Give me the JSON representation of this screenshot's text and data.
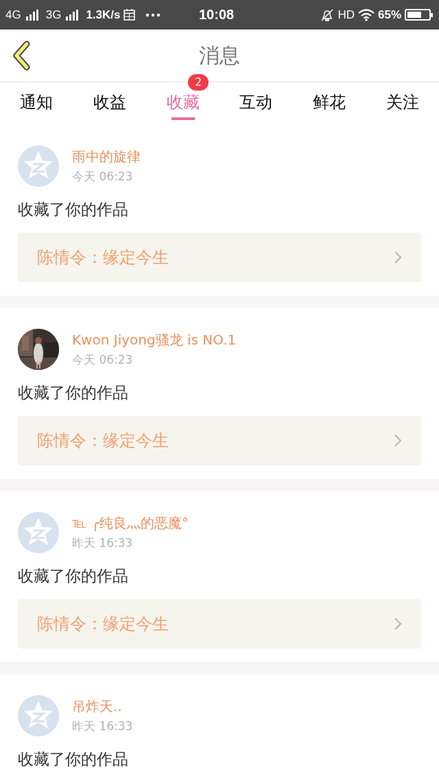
{
  "status_bar": {
    "network_1": "4G",
    "network_2": "3G",
    "speed": "1.3K/s",
    "time": "10:08",
    "hd": "HD",
    "battery": "65%"
  },
  "header": {
    "title": "消息"
  },
  "tabs": [
    {
      "label": "通知",
      "selected": false
    },
    {
      "label": "收益",
      "selected": false
    },
    {
      "label": "收藏",
      "selected": true,
      "badge": "2"
    },
    {
      "label": "互动",
      "selected": false
    },
    {
      "label": "鲜花",
      "selected": false
    },
    {
      "label": "关注",
      "selected": false
    }
  ],
  "messages": [
    {
      "kind": "default",
      "name": "雨中的旋律",
      "time": "今天 06:23",
      "text": "收藏了你的作品",
      "work": "陈情令：缘定今生"
    },
    {
      "kind": "picture",
      "name": "Kwon Jiyong骚龙 is NO.1",
      "time": "今天 06:23",
      "text": "收藏了你的作品",
      "work": "陈情令：缘定今生"
    },
    {
      "kind": "default",
      "name": "℡ ╭纯良灬的恶魔°",
      "time": "昨天 16:33",
      "text": "收藏了你的作品",
      "work": "陈情令：缘定今生"
    },
    {
      "kind": "default",
      "name": "吊炸天..",
      "time": "昨天 16:33",
      "text": "收藏了你的作品"
    }
  ]
}
